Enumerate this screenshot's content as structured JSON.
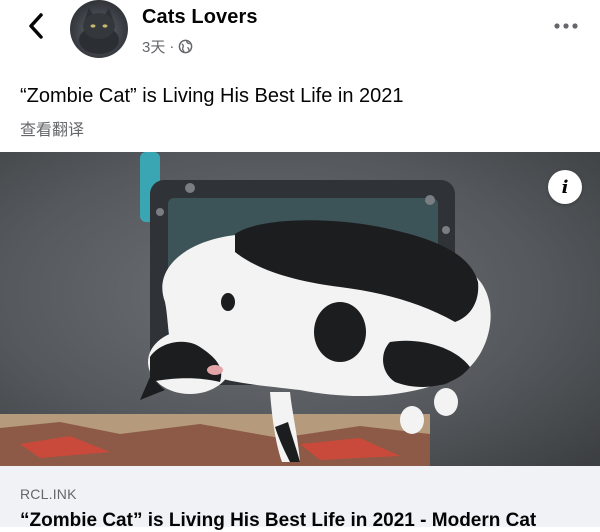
{
  "header": {
    "page_name": "Cats Lovers",
    "time": "3天",
    "separator": "·",
    "audience_icon": "globe-icon",
    "back_icon": "chevron-left-icon",
    "more_icon": "more-horizontal-icon"
  },
  "post": {
    "text": "“Zombie Cat” is Living His Best Life in 2021",
    "translate_label": "查看翻译"
  },
  "media": {
    "info_label": "i"
  },
  "link_preview": {
    "domain": "RCL.INK",
    "title": "“Zombie Cat” is Living His Best Life in 2021 - Modern Cat"
  },
  "colors": {
    "text_primary": "#050505",
    "text_secondary": "#65676b",
    "preview_bg": "#f0f2f5"
  }
}
